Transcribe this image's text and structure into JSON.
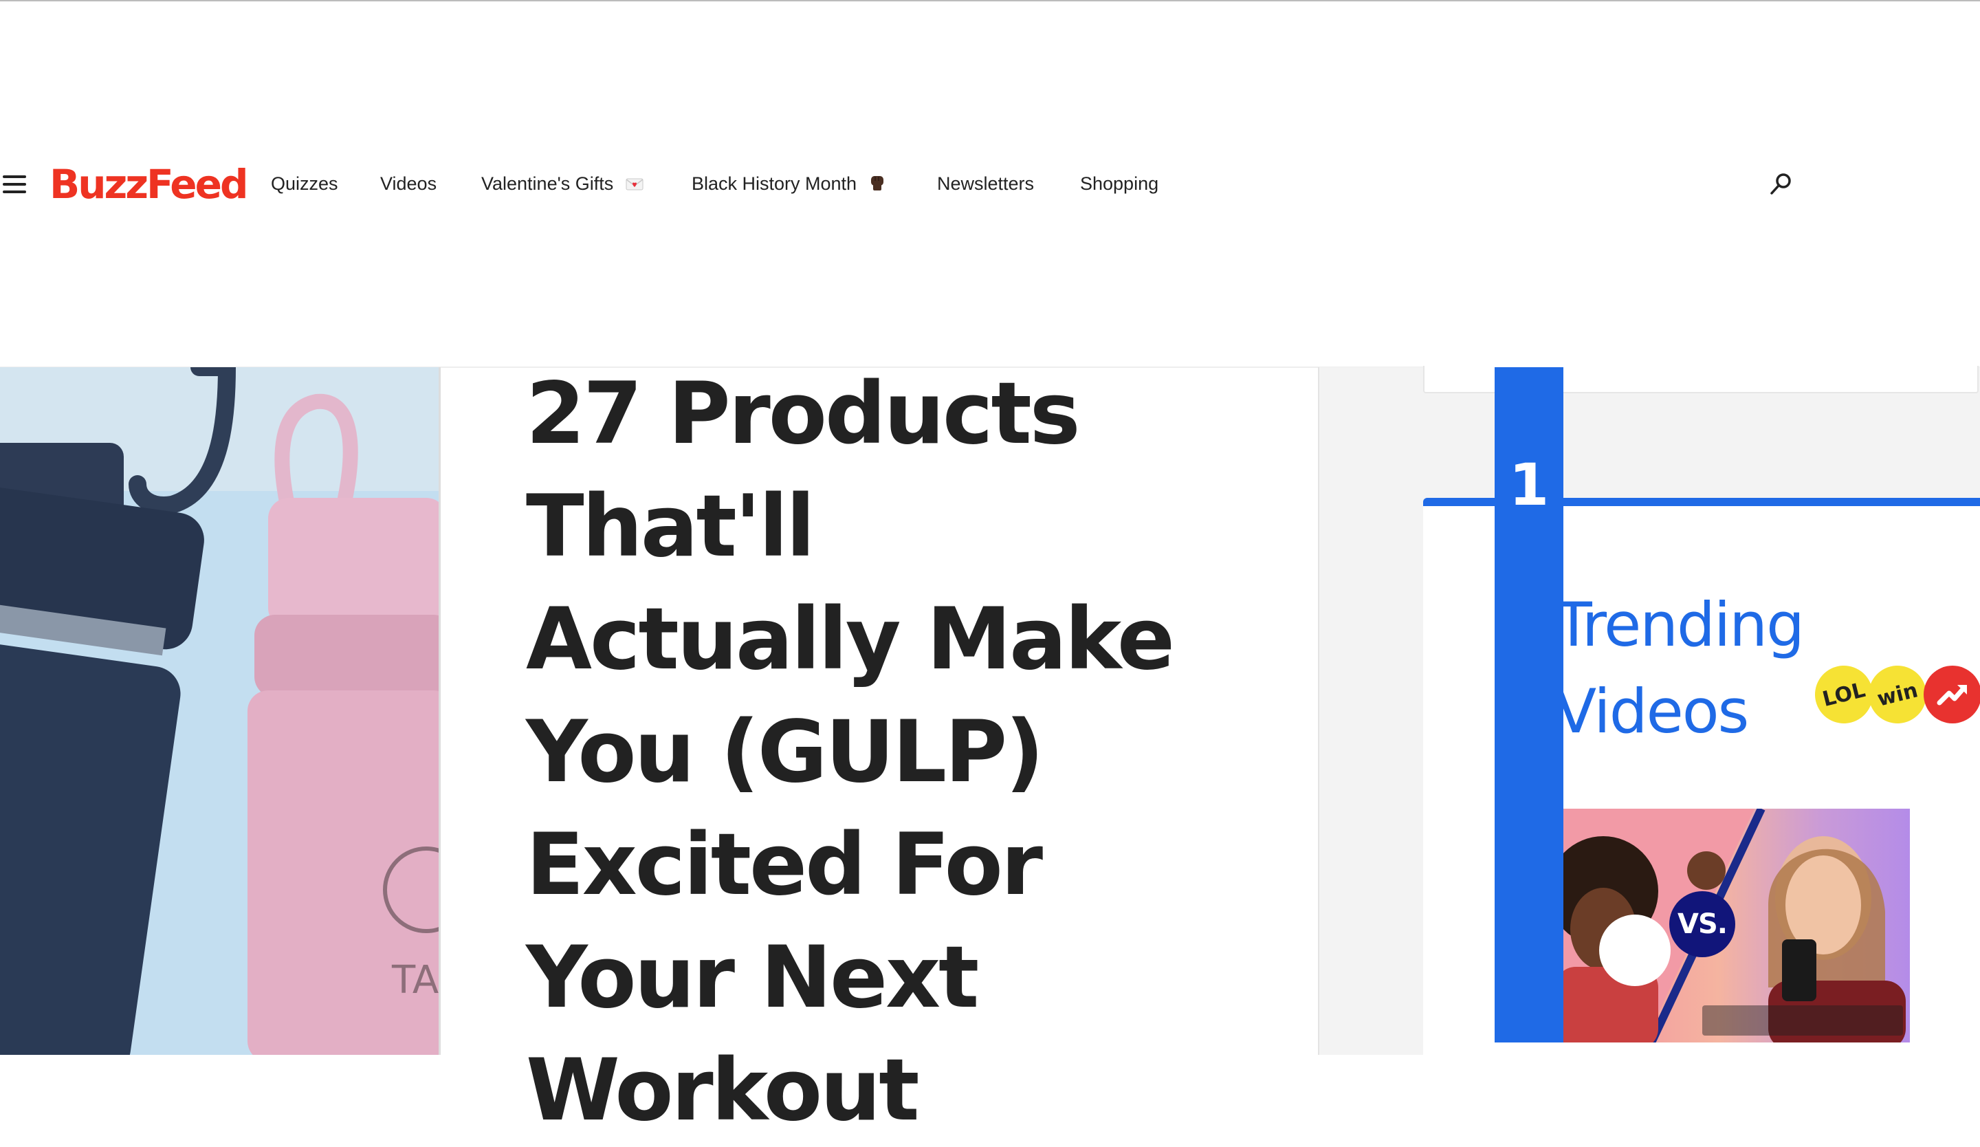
{
  "header": {
    "logo": "BuzzFeed",
    "nav_items": [
      {
        "label": "Quizzes"
      },
      {
        "label": "Videos"
      },
      {
        "label": "Valentine's Gifts"
      },
      {
        "label": "Black History Month"
      },
      {
        "label": "Newsletters"
      },
      {
        "label": "Shopping"
      }
    ],
    "brand_color": "#e32e22"
  },
  "article": {
    "headline": "27 Products That'll Actually Make You (GULP) Excited For Your Next Workout"
  },
  "sidebar": {
    "rank": "1",
    "trending_title": "Trending Videos",
    "badges": [
      "LOL",
      "win"
    ],
    "thumbnail_badge": "VS.",
    "accent_color": "#1f6ae6"
  }
}
